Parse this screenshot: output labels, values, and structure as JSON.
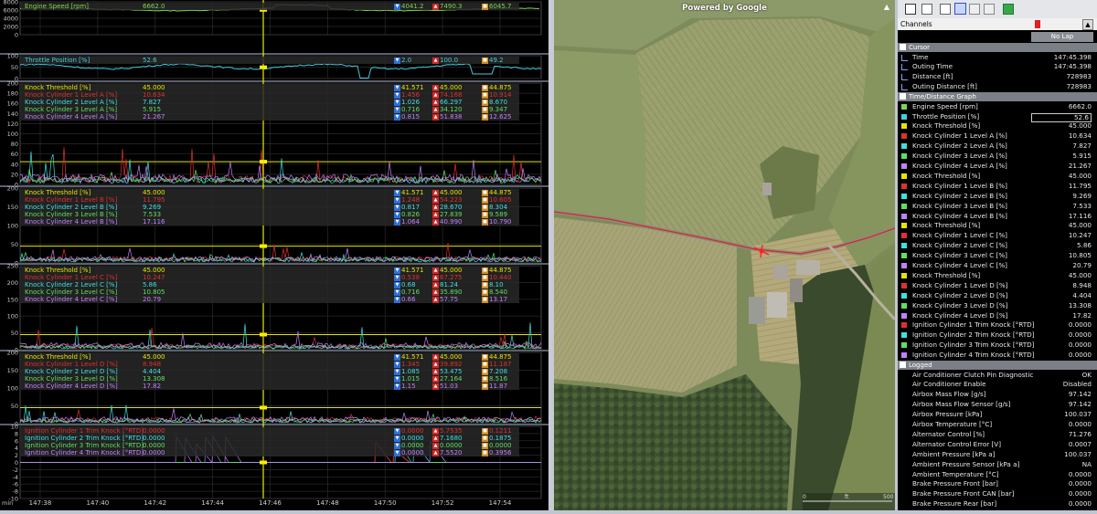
{
  "time_axis": {
    "unit": "min",
    "ticks": [
      "147:38",
      "147:40",
      "147:42",
      "147:44",
      "147:46",
      "147:48",
      "147:50",
      "147:52",
      "147:54"
    ],
    "cursor": "147:45.398"
  },
  "panels": [
    {
      "key": "p1",
      "yticks": [
        "8000",
        "6000",
        "4000",
        "2000",
        "0"
      ],
      "ymin": 0,
      "ymax": 8000,
      "signals": [
        {
          "name": "Engine Speed [rpm]",
          "value": "6662.0",
          "min": "4041.2",
          "max": "7490.3",
          "avg": "6045.7",
          "color": "#7fd44c"
        }
      ]
    },
    {
      "key": "p2",
      "yticks": [
        "100",
        "50",
        "0"
      ],
      "ymin": 0,
      "ymax": 100,
      "signals": [
        {
          "name": "Throttle Position [%]",
          "value": "52.6",
          "min": "2.0",
          "max": "100.0",
          "avg": "49.2",
          "color": "#45cde0"
        }
      ]
    },
    {
      "key": "p3",
      "yticks": [
        "200",
        "180",
        "160",
        "140",
        "120",
        "100",
        "80",
        "60",
        "40",
        "20",
        "0"
      ],
      "ymin": 0,
      "ymax": 200,
      "signals": [
        {
          "name": "Knock Threshold [%]",
          "value": "45.000",
          "min": "41.571",
          "max": "45.000",
          "avg": "44.875",
          "color": "#e6e600"
        },
        {
          "name": "Knock Cylinder 1 Level A [%]",
          "value": "10.634",
          "min": "1.456",
          "max": "74.168",
          "avg": "10.914",
          "color": "#e03030"
        },
        {
          "name": "Knock Cylinder 2 Level A [%]",
          "value": "7.827",
          "min": "1.026",
          "max": "66.297",
          "avg": "8.670",
          "color": "#3ee0e0"
        },
        {
          "name": "Knock Cylinder 3 Level A [%]",
          "value": "5.915",
          "min": "0.716",
          "max": "34.120",
          "avg": "9.347",
          "color": "#60e060"
        },
        {
          "name": "Knock Cylinder 4 Level A [%]",
          "value": "21.267",
          "min": "0.815",
          "max": "51.838",
          "avg": "12.625",
          "color": "#c080ff"
        }
      ]
    },
    {
      "key": "p4",
      "yticks": [
        "200",
        "150",
        "100",
        "50",
        "0"
      ],
      "ymin": 0,
      "ymax": 200,
      "signals": [
        {
          "name": "Knock Threshold [%]",
          "value": "45.000",
          "min": "41.571",
          "max": "45.000",
          "avg": "44.875",
          "color": "#e6e600"
        },
        {
          "name": "Knock Cylinder 1 Level B [%]",
          "value": "11.795",
          "min": "1.248",
          "max": "54.223",
          "avg": "10.605",
          "color": "#e03030"
        },
        {
          "name": "Knock Cylinder 2 Level B [%]",
          "value": "9.269",
          "min": "0.817",
          "max": "28.670",
          "avg": "8.304",
          "color": "#3ee0e0"
        },
        {
          "name": "Knock Cylinder 3 Level B [%]",
          "value": "7.533",
          "min": "0.826",
          "max": "27.839",
          "avg": "9.589",
          "color": "#60e060"
        },
        {
          "name": "Knock Cylinder 4 Level B [%]",
          "value": "17.116",
          "min": "1.064",
          "max": "40.990",
          "avg": "10.790",
          "color": "#c080ff"
        }
      ]
    },
    {
      "key": "p5",
      "yticks": [
        "250",
        "200",
        "150",
        "100",
        "50",
        "0"
      ],
      "ymin": 0,
      "ymax": 250,
      "signals": [
        {
          "name": "Knock Threshold [%]",
          "value": "45.000",
          "min": "41.571",
          "max": "45.000",
          "avg": "44.875",
          "color": "#e6e600"
        },
        {
          "name": "Knock Cylinder 1 Level C [%]",
          "value": "10.247",
          "min": "0.538",
          "max": "67.275",
          "avg": "10.440",
          "color": "#e03030"
        },
        {
          "name": "Knock Cylinder 2 Level C [%]",
          "value": "5.86",
          "min": "0.68",
          "max": "81.24",
          "avg": "8.10",
          "color": "#3ee0e0"
        },
        {
          "name": "Knock Cylinder 3 Level C [%]",
          "value": "10.805",
          "min": "0.716",
          "max": "35.890",
          "avg": "8.540",
          "color": "#60e060"
        },
        {
          "name": "Knock Cylinder 4 Level C [%]",
          "value": "20.79",
          "min": "0.66",
          "max": "57.75",
          "avg": "13.17",
          "color": "#c080ff"
        }
      ]
    },
    {
      "key": "p6",
      "yticks": [
        "200",
        "150",
        "100",
        "50",
        "0"
      ],
      "ymin": 0,
      "ymax": 200,
      "signals": [
        {
          "name": "Knock Threshold [%]",
          "value": "45.000",
          "min": "41.571",
          "max": "45.000",
          "avg": "44.875",
          "color": "#e6e600"
        },
        {
          "name": "Knock Cylinder 1 Level D [%]",
          "value": "8.948",
          "min": "1.345",
          "max": "39.892",
          "avg": "11.187",
          "color": "#e03030"
        },
        {
          "name": "Knock Cylinder 2 Level D [%]",
          "value": "4.404",
          "min": "1.085",
          "max": "53.475",
          "avg": "7.208",
          "color": "#3ee0e0"
        },
        {
          "name": "Knock Cylinder 3 Level D [%]",
          "value": "13.308",
          "min": "1.015",
          "max": "27.164",
          "avg": "8.516",
          "color": "#60e060"
        },
        {
          "name": "Knock Cylinder 4 Level D [%]",
          "value": "17.82",
          "min": "1.15",
          "max": "51.03",
          "avg": "11.87",
          "color": "#c080ff"
        }
      ]
    },
    {
      "key": "p7",
      "yticks": [
        "10",
        "8",
        "6",
        "4",
        "2",
        "0",
        "-2",
        "-4",
        "-6",
        "-8",
        "-10"
      ],
      "ymin": -10,
      "ymax": 10,
      "signals": [
        {
          "name": "Ignition Cylinder 1 Trim Knock [°RTD]",
          "value": "0.0000",
          "min": "0.0000",
          "max": "5.7535",
          "avg": "0.1211",
          "color": "#e03030"
        },
        {
          "name": "Ignition Cylinder 2 Trim Knock [°RTD]",
          "value": "0.0000",
          "min": "0.0000",
          "max": "7.1680",
          "avg": "0.1875",
          "color": "#3ee0e0"
        },
        {
          "name": "Ignition Cylinder 3 Trim Knock [°RTD]",
          "value": "0.0000",
          "min": "0.0000",
          "max": "0.0000",
          "avg": "0.0000",
          "color": "#60e060"
        },
        {
          "name": "Ignition Cylinder 4 Trim Knock [°RTD]",
          "value": "0.0000",
          "min": "0.0000",
          "max": "7.5520",
          "avg": "0.3956",
          "color": "#c080ff"
        }
      ]
    }
  ],
  "map": {
    "title": "Powered by Google",
    "scale_labels": [
      "0",
      "ft",
      "500"
    ]
  },
  "sidebar": {
    "channels_label": "Channels",
    "no_lap_label": "No Lap",
    "sections": [
      {
        "title": "Cursor",
        "items": [
          {
            "name": "Time",
            "value": "147:45.398",
            "color": "#8aa0ff",
            "type": "cursor"
          },
          {
            "name": "Outing Time",
            "value": "147:45.398",
            "color": "#8aa0ff",
            "type": "cursor"
          },
          {
            "name": "Distance [ft]",
            "value": "728983",
            "color": "#8aa0ff",
            "type": "cursor"
          },
          {
            "name": "Outing Distance [ft]",
            "value": "728983",
            "color": "#8aa0ff",
            "type": "cursor"
          }
        ]
      },
      {
        "title": "Time/Distance Graph",
        "items": [
          {
            "name": "Engine Speed [rpm]",
            "value": "6662.0",
            "color": "#7fd44c"
          },
          {
            "name": "Throttle Position [%]",
            "value": "52.6",
            "color": "#45cde0",
            "boxed": true
          },
          {
            "name": "Knock Threshold [%]",
            "value": "45.000",
            "color": "#e6e600"
          },
          {
            "name": "Knock Cylinder 1 Level A [%]",
            "value": "10.634",
            "color": "#e03030"
          },
          {
            "name": "Knock Cylinder 2 Level A [%]",
            "value": "7.827",
            "color": "#3ee0e0"
          },
          {
            "name": "Knock Cylinder 3 Level A [%]",
            "value": "5.915",
            "color": "#60e060"
          },
          {
            "name": "Knock Cylinder 4 Level A [%]",
            "value": "21.267",
            "color": "#c080ff"
          },
          {
            "name": "Knock Threshold [%]",
            "value": "45.000",
            "color": "#e6e600"
          },
          {
            "name": "Knock Cylinder 1 Level B [%]",
            "value": "11.795",
            "color": "#e03030"
          },
          {
            "name": "Knock Cylinder 2 Level B [%]",
            "value": "9.269",
            "color": "#3ee0e0"
          },
          {
            "name": "Knock Cylinder 3 Level B [%]",
            "value": "7.533",
            "color": "#60e060"
          },
          {
            "name": "Knock Cylinder 4 Level B [%]",
            "value": "17.116",
            "color": "#c080ff"
          },
          {
            "name": "Knock Threshold [%]",
            "value": "45.000",
            "color": "#e6e600"
          },
          {
            "name": "Knock Cylinder 1 Level C [%]",
            "value": "10.247",
            "color": "#e03030"
          },
          {
            "name": "Knock Cylinder 2 Level C [%]",
            "value": "5.86",
            "color": "#3ee0e0"
          },
          {
            "name": "Knock Cylinder 3 Level C [%]",
            "value": "10.805",
            "color": "#60e060"
          },
          {
            "name": "Knock Cylinder 4 Level C [%]",
            "value": "20.79",
            "color": "#c080ff"
          },
          {
            "name": "Knock Threshold [%]",
            "value": "45.000",
            "color": "#e6e600"
          },
          {
            "name": "Knock Cylinder 1 Level D [%]",
            "value": "8.948",
            "color": "#e03030"
          },
          {
            "name": "Knock Cylinder 2 Level D [%]",
            "value": "4.404",
            "color": "#3ee0e0"
          },
          {
            "name": "Knock Cylinder 3 Level D [%]",
            "value": "13.308",
            "color": "#60e060"
          },
          {
            "name": "Knock Cylinder 4 Level D [%]",
            "value": "17.82",
            "color": "#c080ff"
          },
          {
            "name": "Ignition Cylinder 1 Trim Knock [°RTD]",
            "value": "0.0000",
            "color": "#e03030"
          },
          {
            "name": "Ignition Cylinder 2 Trim Knock [°RTD]",
            "value": "0.0000",
            "color": "#3ee0e0"
          },
          {
            "name": "Ignition Cylinder 3 Trim Knock [°RTD]",
            "value": "0.0000",
            "color": "#60e060"
          },
          {
            "name": "Ignition Cylinder 4 Trim Knock [°RTD]",
            "value": "0.0000",
            "color": "#c080ff"
          }
        ]
      },
      {
        "title": "Logged",
        "items": [
          {
            "name": "Air Conditioner Clutch Pin Diagnostic",
            "value": "OK"
          },
          {
            "name": "Air Conditioner Enable",
            "value": "Disabled"
          },
          {
            "name": "Airbox Mass Flow [g/s]",
            "value": "97.142"
          },
          {
            "name": "Airbox Mass Flow Sensor [g/s]",
            "value": "97.142"
          },
          {
            "name": "Airbox Pressure [kPa]",
            "value": "100.037"
          },
          {
            "name": "Airbox Temperature [°C]",
            "value": "0.0000"
          },
          {
            "name": "Alternator Control [%]",
            "value": "71.276"
          },
          {
            "name": "Alternator Control Error [V]",
            "value": "0.0007"
          },
          {
            "name": "Ambient Pressure [kPa a]",
            "value": "100.037"
          },
          {
            "name": "Ambient Pressure Sensor [kPa a]",
            "value": "NA"
          },
          {
            "name": "Ambient Temperature [°C]",
            "value": "0.0000"
          },
          {
            "name": "Brake Pressure Front [bar]",
            "value": "0.0000"
          },
          {
            "name": "Brake Pressure Front CAN [bar]",
            "value": "0.0000"
          },
          {
            "name": "Brake Pressure Rear [bar]",
            "value": "0.0000"
          }
        ]
      }
    ]
  }
}
